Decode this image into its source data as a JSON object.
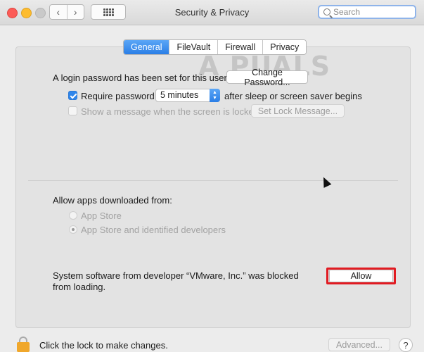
{
  "window": {
    "title": "Security & Privacy"
  },
  "toolbar": {
    "back_icon": "chevron-left-icon",
    "forward_icon": "chevron-right-icon",
    "grid_icon": "show-all-grid-icon"
  },
  "search": {
    "placeholder": "Search",
    "value": ""
  },
  "tabs": [
    {
      "label": "General",
      "active": true
    },
    {
      "label": "FileVault",
      "active": false
    },
    {
      "label": "Firewall",
      "active": false
    },
    {
      "label": "Privacy",
      "active": false
    }
  ],
  "general": {
    "login_text": "A login password has been set for this user",
    "change_password_label": "Change Password...",
    "require_password": {
      "label": "Require password",
      "checked": true
    },
    "require_delay": {
      "value": "5 minutes"
    },
    "after_sleep_text": "after sleep or screen saver begins",
    "show_message": {
      "label": "Show a message when the screen is locked",
      "checked": false,
      "enabled": false
    },
    "set_lock_message_label": "Set Lock Message..."
  },
  "allow_apps": {
    "heading": "Allow apps downloaded from:",
    "options": [
      {
        "label": "App Store",
        "selected": false
      },
      {
        "label": "App Store and identified developers",
        "selected": true
      }
    ]
  },
  "blocked": {
    "line1": "System software from developer “VMware, Inc.” was blocked",
    "line2": "from loading.",
    "allow_label": "Allow"
  },
  "footer": {
    "lock_text": "Click the lock to make changes.",
    "advanced_label": "Advanced...",
    "help_label": "?"
  },
  "watermark": "A PUALS",
  "colors": {
    "accent": "#2a7ee6",
    "highlight": "#e11b22",
    "lock": "#f0a72b"
  }
}
